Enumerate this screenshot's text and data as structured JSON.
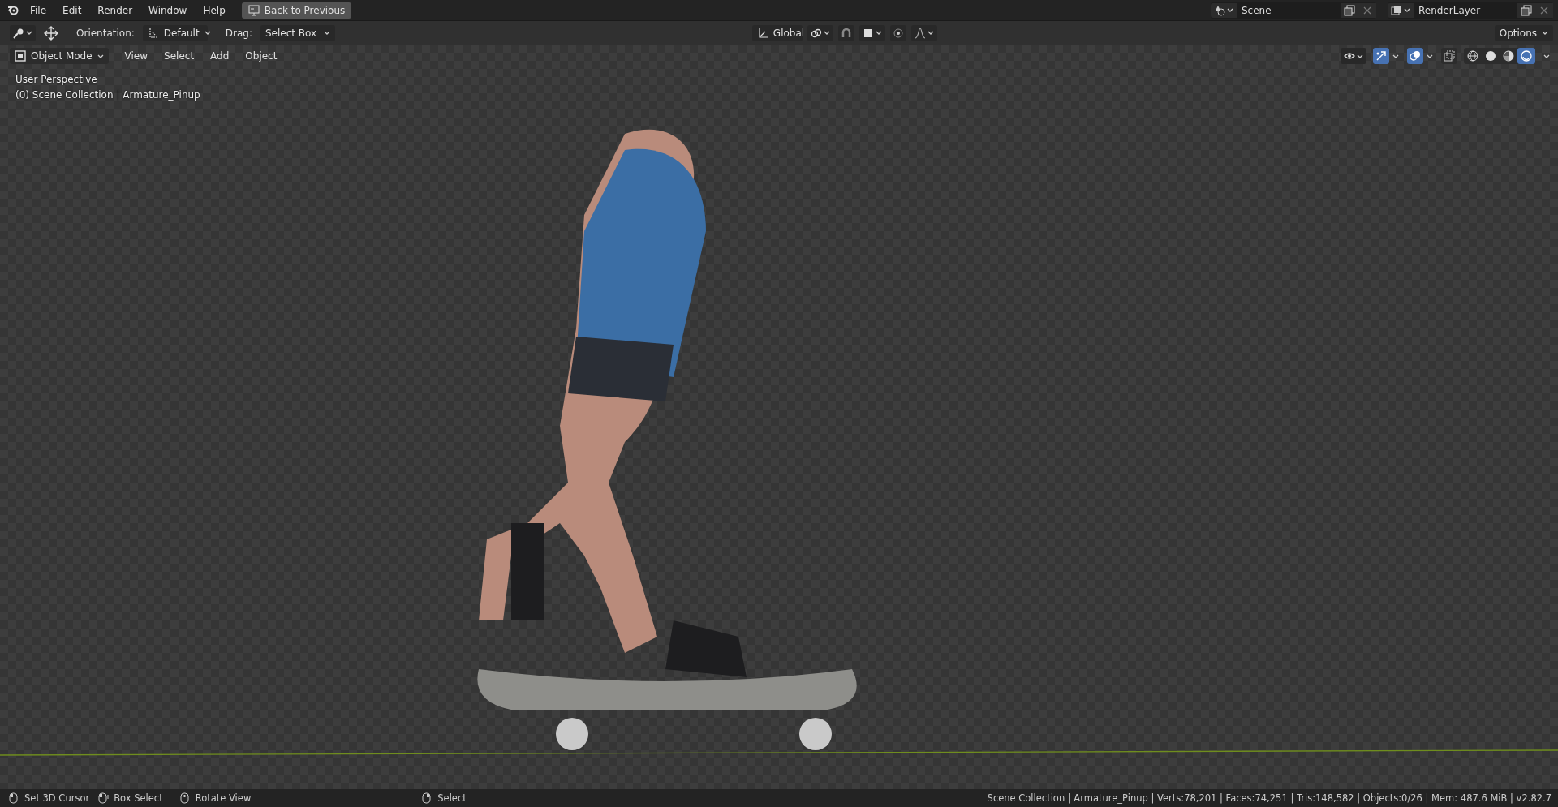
{
  "topbar": {
    "menus": [
      "File",
      "Edit",
      "Render",
      "Window",
      "Help"
    ],
    "back_button": "Back to Previous",
    "scene": "Scene",
    "render_layer": "RenderLayer"
  },
  "tool_header": {
    "orientation_label": "Orientation:",
    "orientation": "Default",
    "drag_label": "Drag:",
    "drag": "Select Box",
    "transform_orientation": "Global",
    "snap": false,
    "proportional": false,
    "options": "Options"
  },
  "viewport_header": {
    "mode": "Object Mode",
    "menus": [
      "View",
      "Select",
      "Add",
      "Object"
    ],
    "gizmos": true,
    "overlays": true,
    "xray": false,
    "shading_modes": [
      {
        "kind": "wireframe",
        "selected": false
      },
      {
        "kind": "solid",
        "selected": false
      },
      {
        "kind": "material",
        "selected": false
      },
      {
        "kind": "rendered",
        "selected": true
      }
    ]
  },
  "viewport": {
    "view_name": "User Perspective",
    "collection": "(0) Scene Collection | Armature_Pinup"
  },
  "status_bar": {
    "hints": [
      {
        "kind": "left",
        "label": "Set 3D Cursor"
      },
      {
        "kind": "drag",
        "label": "Box Select"
      },
      {
        "kind": "middle",
        "label": "Rotate View"
      },
      {
        "kind": "right",
        "label": "Select"
      }
    ],
    "stats": "Scene Collection | Armature_Pinup | Verts:78,201 | Faces:74,251 | Tris:148,582 | Objects:0/26 | Mem: 487.6 MiB | v2.82.7"
  }
}
